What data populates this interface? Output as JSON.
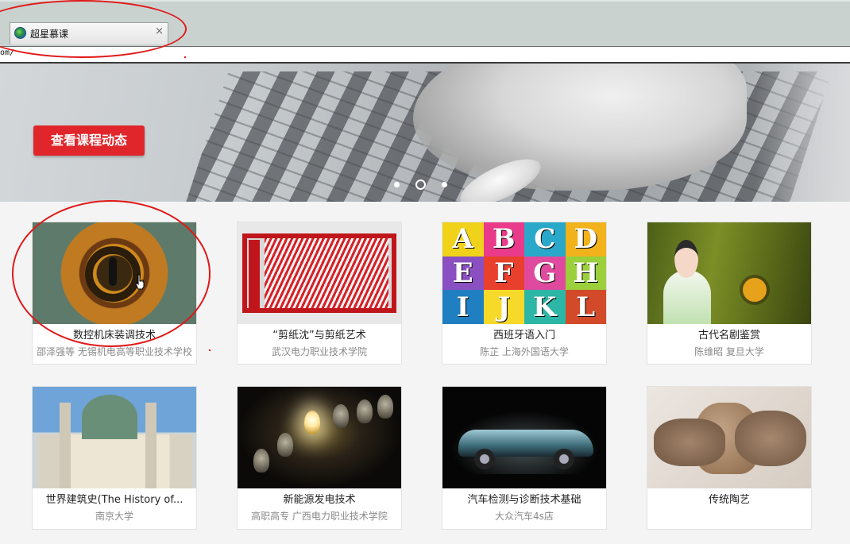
{
  "browser": {
    "tab_title": "超星慕课",
    "tab_close": "×",
    "address": "om/"
  },
  "banner": {
    "cta_label": "查看课程动态",
    "slides": 3,
    "active_slide": 1
  },
  "courses": [
    {
      "title": "数控机床装调技术",
      "meta": "邵泽强等 无锡机电高等职业技术学校"
    },
    {
      "title": "“剪纸沈”与剪纸艺术",
      "meta": "武汉电力职业技术学院"
    },
    {
      "title": "西班牙语入门",
      "meta": "陈芷 上海外国语大学"
    },
    {
      "title": "古代名剧鉴赏",
      "meta": "陈维昭 复旦大学"
    },
    {
      "title": "世界建筑史(The History of...",
      "meta": "南京大学"
    },
    {
      "title": "新能源发电技术",
      "meta": "高职高专 广西电力职业技术学院"
    },
    {
      "title": "汽车检测与诊断技术基础",
      "meta": "大众汽车4s店"
    },
    {
      "title": "传统陶艺",
      "meta": ""
    }
  ],
  "letters": [
    "A",
    "B",
    "C",
    "D",
    "E",
    "F",
    "G",
    "H",
    "I",
    "J",
    "K",
    "L"
  ],
  "colors": {
    "cta": "#e0262b",
    "annotation": "#e01818"
  }
}
